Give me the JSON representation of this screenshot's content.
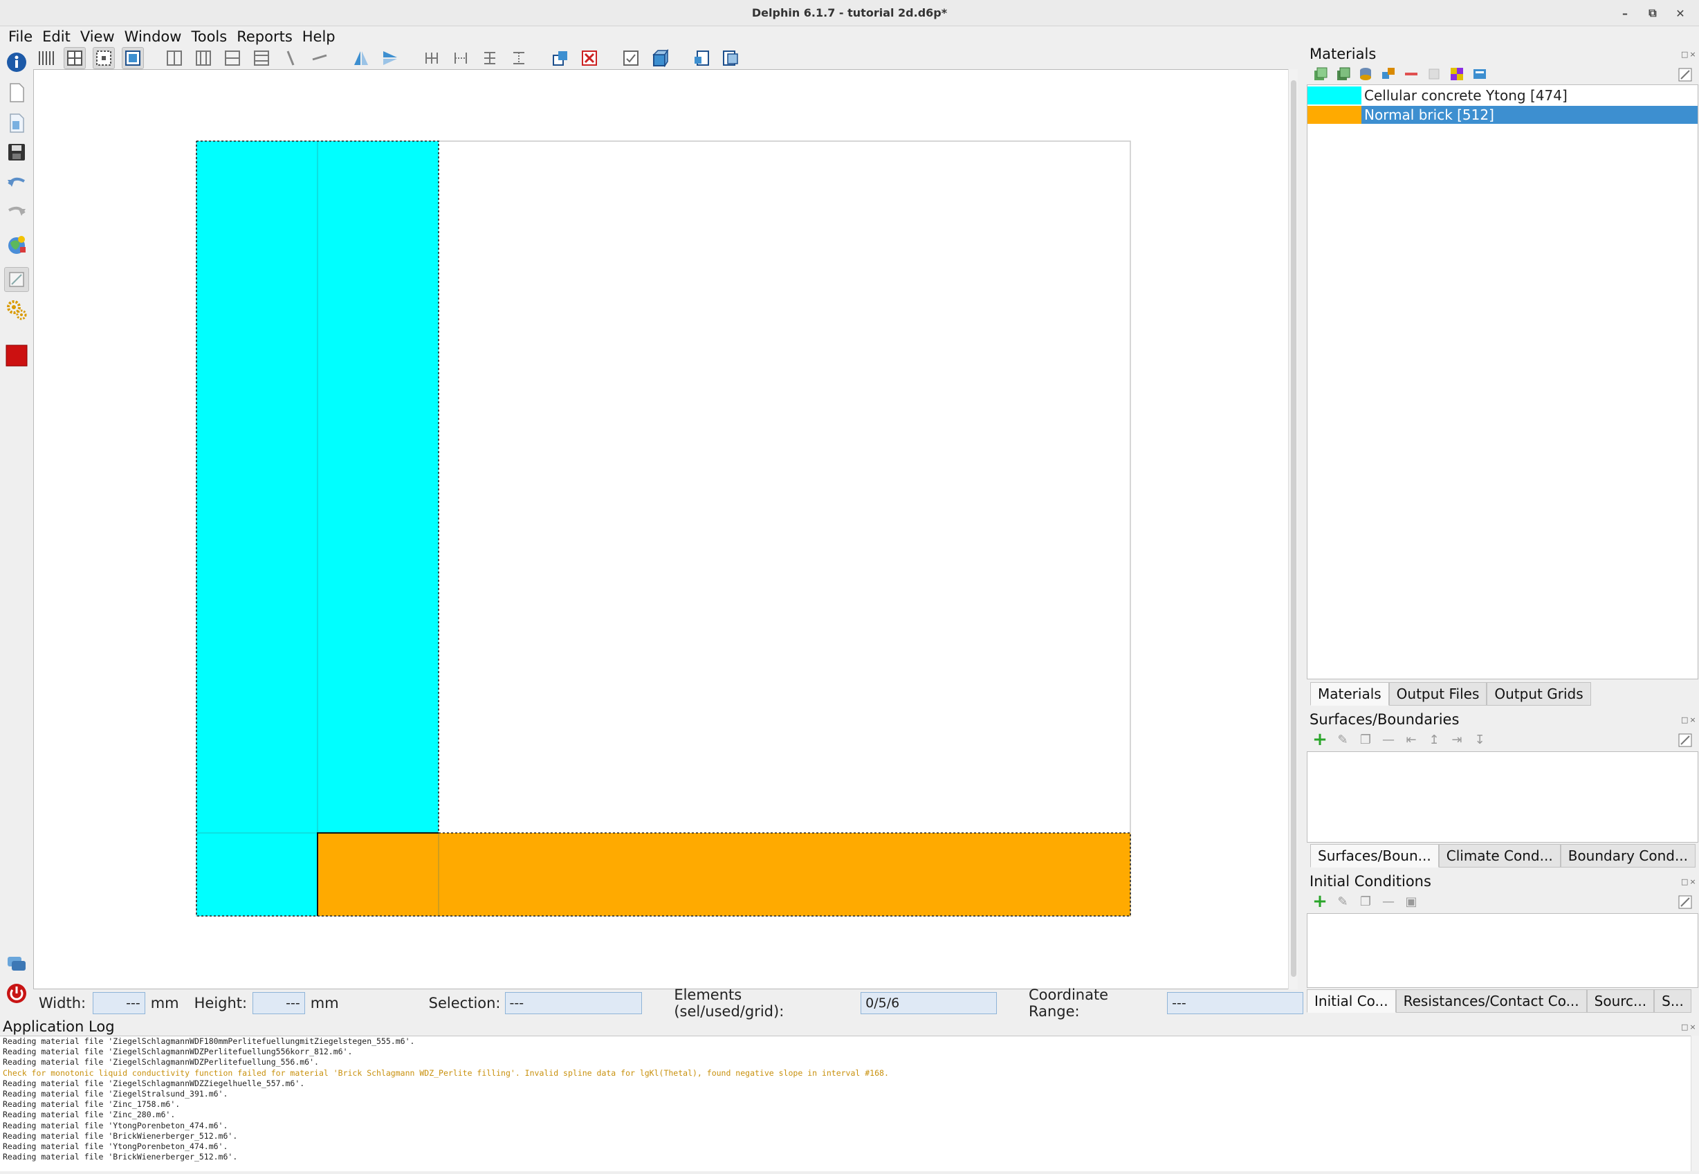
{
  "window": {
    "title": "Delphin 6.1.7 - tutorial 2d.d6p*"
  },
  "menu": [
    "File",
    "Edit",
    "View",
    "Window",
    "Tools",
    "Reports",
    "Help"
  ],
  "materials": {
    "title": "Materials",
    "items": [
      {
        "label": "Cellular concrete Ytong [474]",
        "color": "#00ffff",
        "selected": false
      },
      {
        "label": "Normal brick [512]",
        "color": "#ffaa00",
        "selected": true
      }
    ],
    "tabs": [
      "Materials",
      "Output Files",
      "Output Grids"
    ]
  },
  "surfaces": {
    "title": "Surfaces/Boundaries",
    "tabs": [
      "Surfaces/Boun...",
      "Climate Cond...",
      "Boundary Cond..."
    ]
  },
  "initial": {
    "title": "Initial Conditions",
    "tabs": [
      "Initial Co...",
      "Resistances/Contact Co...",
      "Sourc...",
      "S..."
    ]
  },
  "status": {
    "width_label": "Width:",
    "width_value": "---",
    "width_unit": "mm",
    "height_label": "Height:",
    "height_value": "---",
    "height_unit": "mm",
    "selection_label": "Selection:",
    "selection_value": "---",
    "elements_label": "Elements (sel/used/grid):",
    "elements_value": "0/5/6",
    "coord_label": "Coordinate Range:",
    "coord_value": "---"
  },
  "log": {
    "title": "Application Log",
    "lines": [
      {
        "text": "Reading material file 'ZiegelSchlagmannWDF180mmPerlitefuellungmitZiegelstegen_555.m6'.",
        "level": "info"
      },
      {
        "text": "Reading material file 'ZiegelSchlagmannWDZPerlitefuellung556korr_812.m6'.",
        "level": "info"
      },
      {
        "text": "Reading material file 'ZiegelSchlagmannWDZPerlitefuellung_556.m6'.",
        "level": "info"
      },
      {
        "text": "Check for monotonic liquid conductivity function failed for material 'Brick Schlagmann WDZ_Perlite filling'. Invalid spline data for lgKl(Thetal), found negative slope in interval #168.",
        "level": "warn"
      },
      {
        "text": "Reading material file 'ZiegelSchlagmannWDZZiegelhuelle_557.m6'.",
        "level": "info"
      },
      {
        "text": "Reading material file 'ZiegelStralsund_391.m6'.",
        "level": "info"
      },
      {
        "text": "Reading material file 'Zinc_1758.m6'.",
        "level": "info"
      },
      {
        "text": "Reading material file 'Zinc_280.m6'.",
        "level": "info"
      },
      {
        "text": "Reading material file 'YtongPorenbeton_474.m6'.",
        "level": "info"
      },
      {
        "text": "Reading material file 'BrickWienerberger_512.m6'.",
        "level": "info"
      },
      {
        "text": "Reading material file 'YtongPorenbeton_474.m6'.",
        "level": "info"
      },
      {
        "text": "Reading material file 'BrickWienerberger_512.m6'.",
        "level": "info"
      }
    ]
  }
}
